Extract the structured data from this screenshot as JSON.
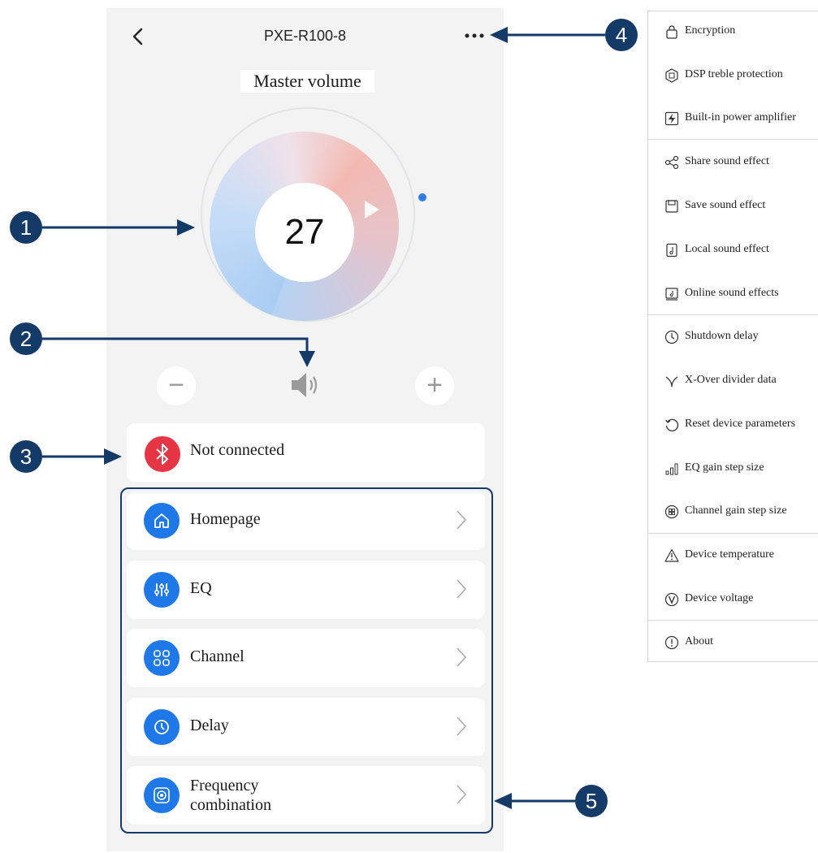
{
  "header": {
    "title": "PXE-R100-8"
  },
  "volume": {
    "title": "Master volume",
    "value": "27",
    "minus_label": "−",
    "plus_label": "+"
  },
  "connection": {
    "status": "Not connected"
  },
  "menu": [
    {
      "label": "Homepage",
      "icon": "home-icon"
    },
    {
      "label": "EQ",
      "icon": "equalizer-icon"
    },
    {
      "label": "Channel",
      "icon": "channel-grid-icon"
    },
    {
      "label": "Delay",
      "icon": "delay-clock-icon"
    },
    {
      "label": "Frequency combination",
      "label_line1": "Frequency",
      "label_line2": "combination",
      "icon": "frequency-icon"
    }
  ],
  "more_menu": [
    {
      "label": "Encryption",
      "icon": "lock-icon"
    },
    {
      "label": "DSP treble protection",
      "icon": "dsp-icon"
    },
    {
      "label": "Built-in power amplifier",
      "icon": "lightning-icon"
    },
    {
      "label": "Share sound effect",
      "icon": "share-icon"
    },
    {
      "label": "Save sound effect",
      "icon": "save-icon"
    },
    {
      "label": "Local sound effect",
      "icon": "music-file-icon"
    },
    {
      "label": "Online sound effects",
      "icon": "online-music-icon"
    },
    {
      "label": "Shutdown delay",
      "icon": "clock-icon"
    },
    {
      "label": "X-Over divider data",
      "icon": "crossover-icon"
    },
    {
      "label": "Reset device parameters",
      "icon": "reset-icon"
    },
    {
      "label": "EQ gain step size",
      "icon": "bars-icon"
    },
    {
      "label": "Channel gain step size",
      "icon": "channel-gain-icon"
    },
    {
      "label": "Device temperature",
      "icon": "warning-icon"
    },
    {
      "label": "Device voltage",
      "icon": "voltage-icon"
    },
    {
      "label": "About",
      "icon": "info-icon"
    }
  ],
  "callouts": [
    "1",
    "2",
    "3",
    "4",
    "5"
  ],
  "colors": {
    "callout": "#143a68",
    "accent": "#1e78e8",
    "bt_red": "#e63646",
    "background": "#f3f3f4"
  }
}
